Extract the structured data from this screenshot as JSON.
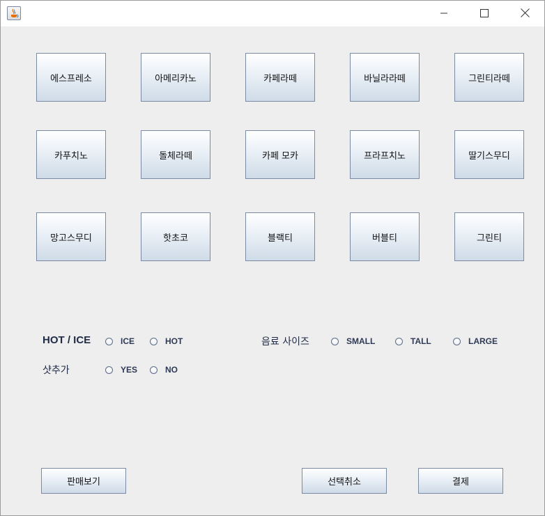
{
  "window": {
    "controls": {
      "minimize_icon": "minimize-icon",
      "maximize_icon": "maximize-icon",
      "close_icon": "close-icon"
    }
  },
  "menu": {
    "row1": [
      "에스프레소",
      "아메리카노",
      "카페라떼",
      "바닐라라떼",
      "그린티라떼"
    ],
    "row2": [
      "카푸치노",
      "돌체라떼",
      "카페 모카",
      "프라프치노",
      "딸기스무디"
    ],
    "row3": [
      "망고스무디",
      "핫초코",
      "블랙티",
      "버블티",
      "그린티"
    ]
  },
  "options": {
    "temperature": {
      "label": "HOT / ICE",
      "choices": [
        "ICE",
        "HOT"
      ]
    },
    "size": {
      "label": "음료 사이즈",
      "choices": [
        "SMALL",
        "TALL",
        "LARGE"
      ]
    },
    "shot": {
      "label": "샷추가",
      "choices": [
        "YES",
        "NO"
      ]
    }
  },
  "actions": {
    "sales": "판매보기",
    "cancel": "선택취소",
    "pay": "결제"
  },
  "colors": {
    "background": "#eeeeee",
    "button_border": "#7a8aa3",
    "button_gradient_bottom": "#cfdbe8",
    "label_text": "#1f2a44"
  }
}
